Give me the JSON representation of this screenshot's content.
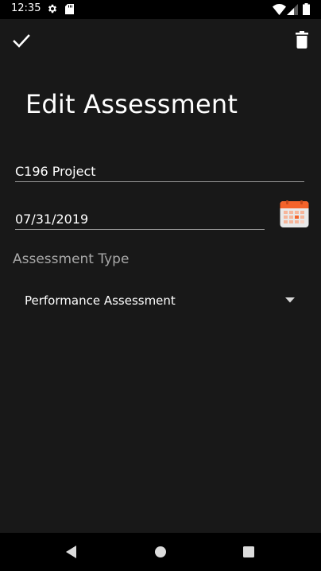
{
  "status_bar": {
    "time": "12:35",
    "icons": [
      "gear-icon",
      "sd-card-icon",
      "wifi-icon",
      "signal-icon",
      "battery-icon"
    ]
  },
  "toolbar": {
    "confirm_icon": "check-icon",
    "delete_icon": "trash-icon"
  },
  "page": {
    "title": "Edit Assessment"
  },
  "form": {
    "name_value": "C196 Project",
    "date_value": "07/31/2019",
    "calendar_icon": "calendar-icon",
    "type_label": "Assessment Type",
    "type_selected": "Performance Assessment"
  },
  "nav_bar": {
    "icons": [
      "back-icon",
      "home-icon",
      "recents-icon"
    ]
  },
  "colors": {
    "background": "#181818",
    "bars": "#000000",
    "text": "#ffffff",
    "label": "#a8a8a8",
    "underline": "#9a9a9a",
    "calendar_header": "#f4632a",
    "calendar_body": "#e9e9e9"
  }
}
